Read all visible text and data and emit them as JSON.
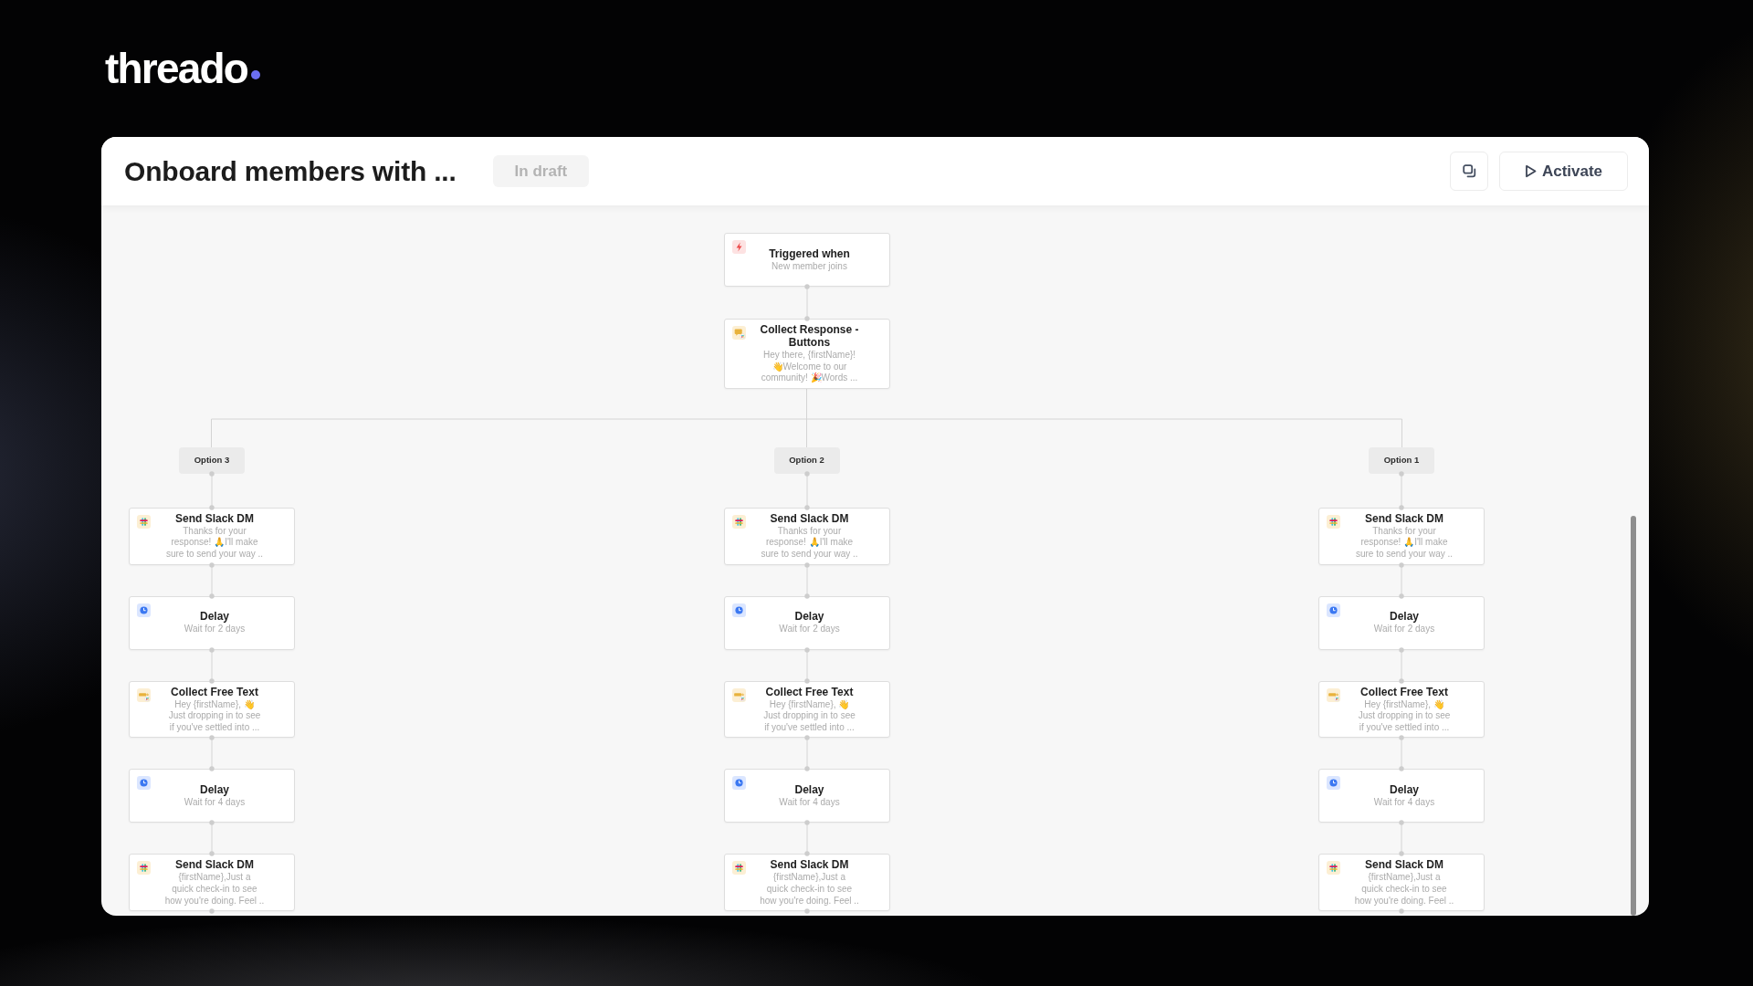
{
  "logo": {
    "wordmark": "threado"
  },
  "workflow": {
    "title": "Onboard members with ...",
    "status": "In draft",
    "activate_button": "Activate"
  },
  "flow": {
    "nodes": [
      {
        "kind": "trigger",
        "title": "Triggered when",
        "subtitle": "New member joins"
      },
      {
        "kind": "collect_buttons",
        "title": "Collect Response - Buttons",
        "subtitle": "Hey there, {firstName}!\n👋Welcome to our\ncommunity! 🎉Words ..."
      }
    ],
    "branches": [
      {
        "label": "Option 3",
        "steps": [
          {
            "kind": "slack_dm",
            "title": "Send Slack DM",
            "subtitle": "Thanks for your\nresponse! 🙏I'll make\nsure to send your way .."
          },
          {
            "kind": "delay",
            "title": "Delay",
            "subtitle": "Wait for 2 days"
          },
          {
            "kind": "collect_text",
            "title": "Collect Free Text",
            "subtitle": "Hey {firstName}, 👋\nJust dropping in to see\nif you've settled into ..."
          },
          {
            "kind": "delay",
            "title": "Delay",
            "subtitle": "Wait for 4 days"
          },
          {
            "kind": "slack_dm",
            "title": "Send Slack DM",
            "subtitle": "{firstName},Just a\nquick check-in to see\nhow you're doing. Feel .."
          }
        ]
      },
      {
        "label": "Option 2",
        "steps": [
          {
            "kind": "slack_dm",
            "title": "Send Slack DM",
            "subtitle": "Thanks for your\nresponse! 🙏I'll make\nsure to send your way .."
          },
          {
            "kind": "delay",
            "title": "Delay",
            "subtitle": "Wait for 2 days"
          },
          {
            "kind": "collect_text",
            "title": "Collect Free Text",
            "subtitle": "Hey {firstName}, 👋\nJust dropping in to see\nif you've settled into ..."
          },
          {
            "kind": "delay",
            "title": "Delay",
            "subtitle": "Wait for 4 days"
          },
          {
            "kind": "slack_dm",
            "title": "Send Slack DM",
            "subtitle": "{firstName},Just a\nquick check-in to see\nhow you're doing. Feel .."
          }
        ]
      },
      {
        "label": "Option 1",
        "steps": [
          {
            "kind": "slack_dm",
            "title": "Send Slack DM",
            "subtitle": "Thanks for your\nresponse! 🙏I'll make\nsure to send your way .."
          },
          {
            "kind": "delay",
            "title": "Delay",
            "subtitle": "Wait for 2 days"
          },
          {
            "kind": "collect_text",
            "title": "Collect Free Text",
            "subtitle": "Hey {firstName}, 👋\nJust dropping in to see\nif you've settled into ..."
          },
          {
            "kind": "delay",
            "title": "Delay",
            "subtitle": "Wait for 4 days"
          },
          {
            "kind": "slack_dm",
            "title": "Send Slack DM",
            "subtitle": "{firstName},Just a\nquick check-in to see\nhow you're doing. Feel .."
          }
        ]
      }
    ]
  }
}
